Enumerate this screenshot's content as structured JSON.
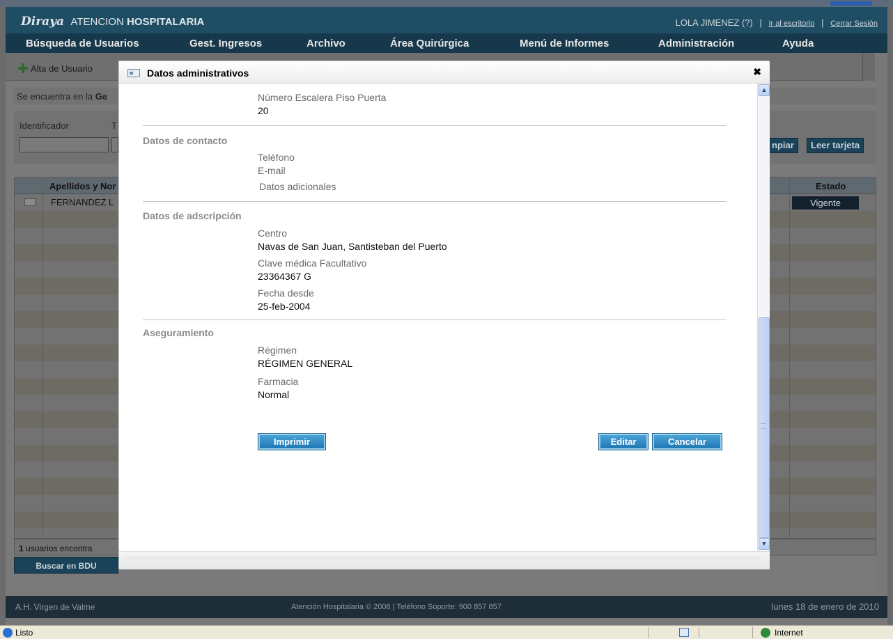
{
  "app": {
    "logo_brand": "Diraya",
    "logo_text": "ATENCION",
    "logo_bold": "HOSPITALARIA",
    "user": "LOLA JIMENEZ (?)",
    "link_desktop": "Ir al escritorio",
    "link_logout": "Cerrar Sesión",
    "separator": "|"
  },
  "menu": [
    "Búsqueda de Usuarios",
    "Gest. Ingresos",
    "Archivo",
    "Área Quirúrgica",
    "Menú de Informes",
    "Administración",
    "Ayuda"
  ],
  "toolbar": {
    "alta_label": "Alta de Usuario"
  },
  "location": {
    "prefix": "Se encuentra en la",
    "bold": "Ge"
  },
  "filters": {
    "identificador_label": "Identificador",
    "t_label": "T",
    "btn_limpiar": "npiar",
    "btn_leer": "Leer tarjeta"
  },
  "grid": {
    "col_name": "Apellidos y Nor",
    "col_estado": "Estado",
    "col_mid": "",
    "rows": [
      {
        "name": "FERNANDEZ L",
        "estado": "Vigente"
      }
    ],
    "footer_count": "1",
    "footer_text": "usuarios encontra"
  },
  "buscar_label": "Buscar en BDU",
  "footer": {
    "left": "A.H. Virgen de Valme",
    "center": "Atención Hospitalaria © 2008 | Teléfono Soporte: 900 857 857",
    "right": "lunes 18 de enero de 2010"
  },
  "status": {
    "text": "Listo",
    "zone": "Internet"
  },
  "modal": {
    "title": "Datos administrativos",
    "close": "✖",
    "address": {
      "labels": "Número  Escalera  Piso  Puerta",
      "value": "20"
    },
    "contacto": {
      "title": "Datos de contacto",
      "telefono": "Teléfono",
      "email": "E-mail",
      "adicionales": "Datos adicionales"
    },
    "adscripcion": {
      "title": "Datos de adscripción",
      "centro_label": "Centro",
      "centro_value": "Navas de San Juan, Santisteban del Puerto",
      "clave_label": "Clave médica  Facultativo",
      "clave_value": "23364367 G",
      "fecha_label": "Fecha desde",
      "fecha_value": "25-feb-2004"
    },
    "aseguramiento": {
      "title": "Aseguramiento",
      "regimen_label": "Régimen",
      "regimen_value": "RÉGIMEN GENERAL",
      "farmacia_label": "Farmacia",
      "farmacia_value": "Normal"
    },
    "buttons": {
      "imprimir": "Imprimir",
      "editar": "Editar",
      "cancelar": "Cancelar"
    },
    "scroll_position": 0.55
  }
}
